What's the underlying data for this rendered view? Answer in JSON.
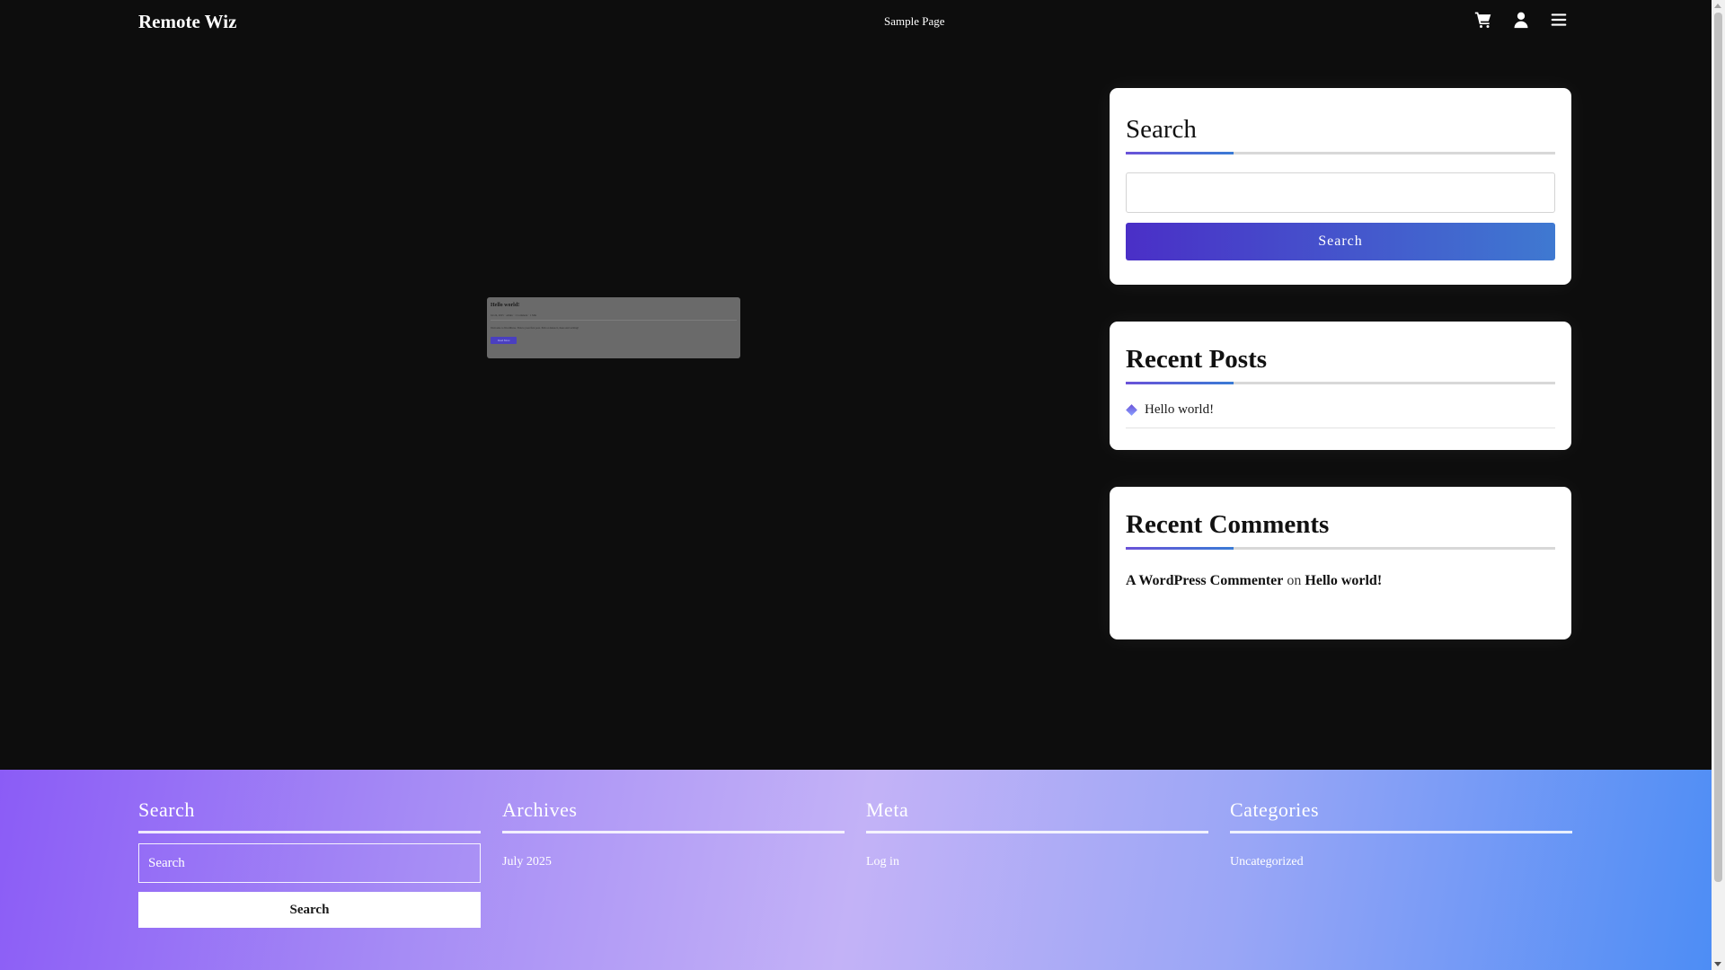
{
  "header": {
    "site_title": "Remote Wiz",
    "nav": {
      "sample_page": "Sample Page"
    },
    "icons": [
      "cart-icon",
      "user-icon",
      "menu-icon"
    ]
  },
  "preview": {
    "title": "Hello world!",
    "meta": "Jul 24, 2025 · admin · 1 Comment · 1 Min",
    "excerpt": "Welcome to WordPress. This is your first post. Edit or delete it, then start writing!",
    "button": "Read More"
  },
  "sidebar": {
    "search": {
      "title": "Search",
      "button": "Search",
      "value": ""
    },
    "recent_posts": {
      "title": "Recent Posts",
      "items": [
        "Hello world!"
      ]
    },
    "recent_comments": {
      "title": "Recent Comments",
      "author": "A WordPress Commenter",
      "on": "on",
      "post": "Hello world!"
    }
  },
  "footer": {
    "search": {
      "title": "Search",
      "placeholder": "Search",
      "button": "Search"
    },
    "archives": {
      "title": "Archives",
      "items": [
        "July 2025"
      ]
    },
    "meta": {
      "title": "Meta",
      "items": [
        "Log in"
      ]
    },
    "categories": {
      "title": "Categories",
      "items": [
        "Uncategorized"
      ]
    }
  },
  "colors": {
    "accent_start": "#4a2fc7",
    "accent_end": "#3f79d1",
    "footer_gradient": [
      "#8b5cf6",
      "#c3b2f7",
      "#4d8df5"
    ]
  }
}
